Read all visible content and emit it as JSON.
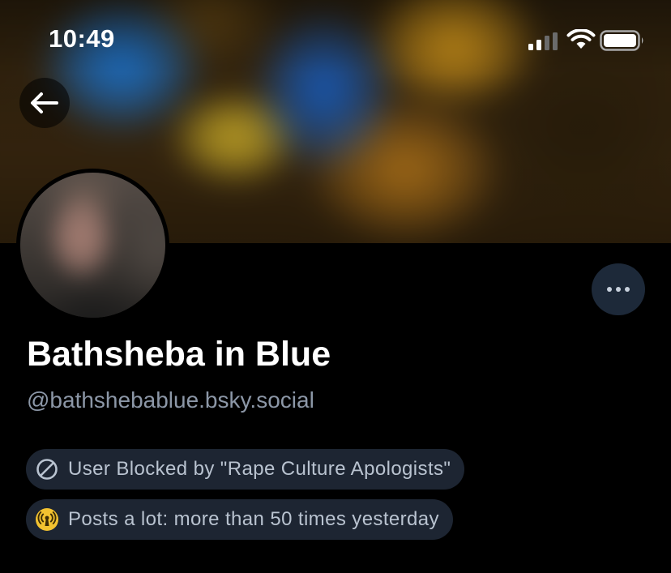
{
  "status_bar": {
    "time": "10:49"
  },
  "profile": {
    "display_name": "Bathsheba in Blue",
    "handle": "@bathshebablue.bsky.social"
  },
  "labels": [
    {
      "icon": "block-icon",
      "text": "User Blocked by \"Rape Culture Apologists\""
    },
    {
      "icon": "broadcast-icon",
      "text": "Posts a lot: more than 50 times yesterday"
    }
  ],
  "colors": {
    "background": "#000000",
    "handle_text": "#8c97a7",
    "pill_background": "#1d2532",
    "pill_text": "#b9c3d0",
    "more_button_background": "#1d2939",
    "broadcast_icon": "#f2c230"
  }
}
